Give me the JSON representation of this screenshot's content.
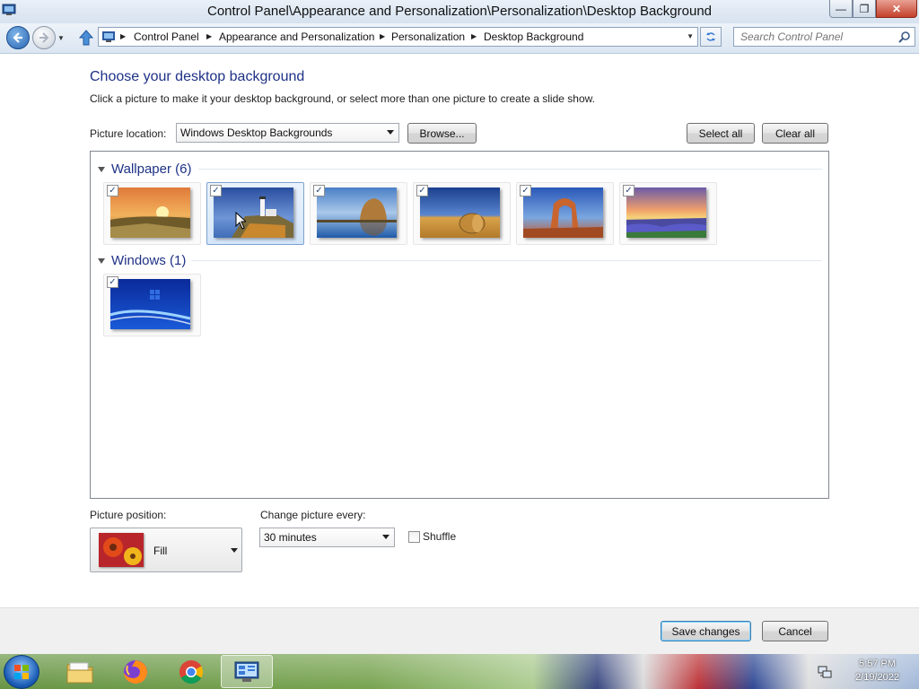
{
  "window": {
    "title": "Control Panel\\Appearance and Personalization\\Personalization\\Desktop Background",
    "minimize_symbol": "—",
    "maximize_symbol": "❐",
    "close_symbol": "✕"
  },
  "address": {
    "breadcrumbs": [
      "Control Panel",
      "Appearance and Personalization",
      "Personalization",
      "Desktop Background"
    ],
    "search_placeholder": "Search Control Panel"
  },
  "page": {
    "heading": "Choose your desktop background",
    "subtext": "Click a picture to make it your desktop background, or select more than one picture to create a slide show."
  },
  "location": {
    "label": "Picture location:",
    "selected": "Windows Desktop Backgrounds",
    "browse_label": "Browse...",
    "select_all_label": "Select all",
    "clear_all_label": "Clear all"
  },
  "groups": [
    {
      "title": "Wallpaper (6)",
      "items": [
        {
          "name": "sunset-field",
          "checked": true,
          "selected": false
        },
        {
          "name": "lighthouse",
          "checked": true,
          "selected": true
        },
        {
          "name": "rock-lake",
          "checked": true,
          "selected": false
        },
        {
          "name": "hay-bale",
          "checked": true,
          "selected": false
        },
        {
          "name": "stone-arch",
          "checked": true,
          "selected": false
        },
        {
          "name": "lupine-lake",
          "checked": true,
          "selected": false
        }
      ]
    },
    {
      "title": "Windows (1)",
      "items": [
        {
          "name": "windows-blue",
          "checked": true,
          "selected": false
        }
      ]
    }
  ],
  "checkmark": "✓",
  "position": {
    "label": "Picture position:",
    "value": "Fill"
  },
  "interval": {
    "label": "Change picture every:",
    "value": "30 minutes"
  },
  "shuffle": {
    "label": "Shuffle",
    "checked": false
  },
  "footer": {
    "save_label": "Save changes",
    "cancel_label": "Cancel"
  },
  "taskbar": {
    "time": "5:57 PM",
    "date": "2/19/2022",
    "items": [
      "file-explorer",
      "firefox",
      "chrome",
      "control-panel"
    ]
  }
}
